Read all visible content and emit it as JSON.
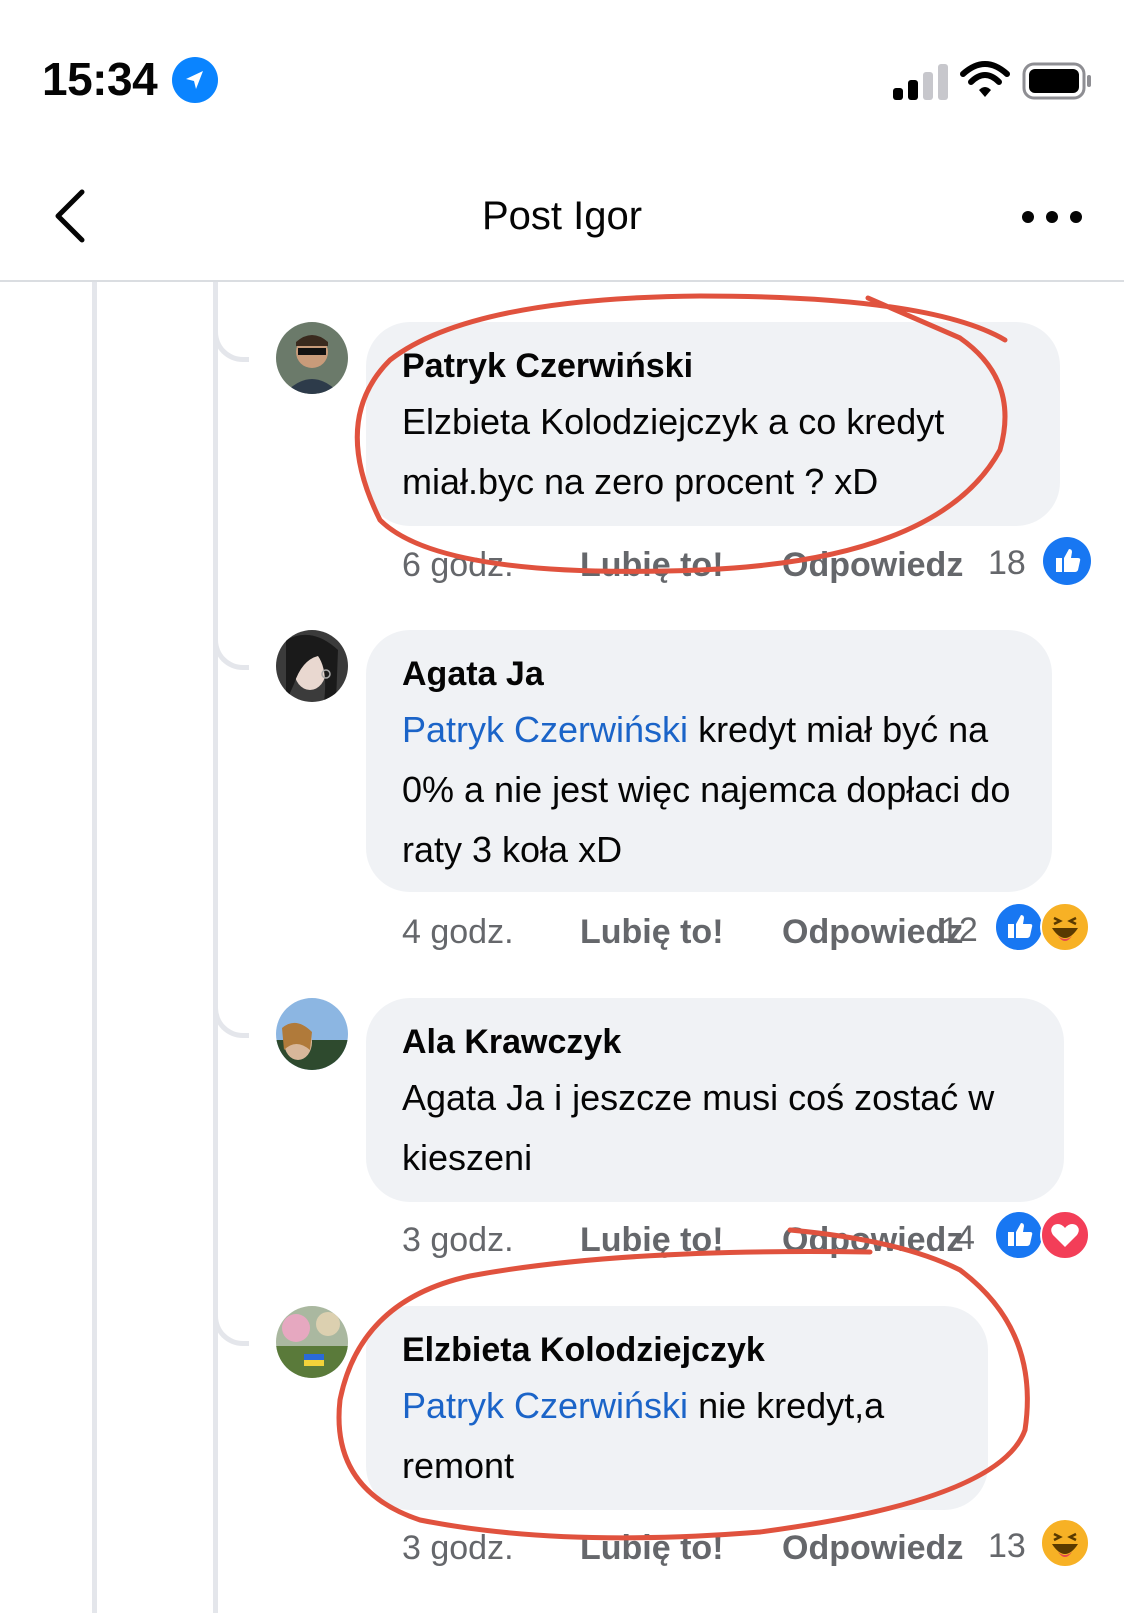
{
  "status": {
    "time": "15:34"
  },
  "nav": {
    "title": "Post Igor"
  },
  "comments": [
    {
      "author": "Patryk Czerwiński",
      "mention": "",
      "text": "Elzbieta Kolodziejczyk a co kredyt miał.byc na zero procent ? xD",
      "time": "6 godz.",
      "like": "Lubię to!",
      "reply": "Odpowiedz",
      "reactions_count": "18",
      "reactions": [
        "like-icon"
      ]
    },
    {
      "author": "Agata Ja",
      "mention": "Patryk Czerwiński",
      "text": " kredyt miał być na 0% a nie jest więc najemca dopłaci do raty 3 koła xD",
      "time": "4 godz.",
      "like": "Lubię to!",
      "reply": "Odpowiedz",
      "reactions_count": "12",
      "reactions": [
        "like-icon",
        "haha-icon"
      ]
    },
    {
      "author": "Ala Krawczyk",
      "mention": "",
      "text": "Agata Ja i jeszcze musi coś zostać w kieszeni",
      "time": "3 godz.",
      "like": "Lubię to!",
      "reply": "Odpowiedz",
      "reactions_count": "4",
      "reactions": [
        "like-icon",
        "love-icon"
      ]
    },
    {
      "author": "Elzbieta Kolodziejczyk",
      "mention": "Patryk Czerwiński",
      "text": " nie kredyt,a remont",
      "time": "3 godz.",
      "like": "Lubię to!",
      "reply": "Odpowiedz",
      "reactions_count": "13",
      "reactions": [
        "haha-icon"
      ]
    }
  ],
  "colors": {
    "accent": "#0a84ff",
    "mention": "#1b64c8",
    "annotation": "#e0523e"
  }
}
